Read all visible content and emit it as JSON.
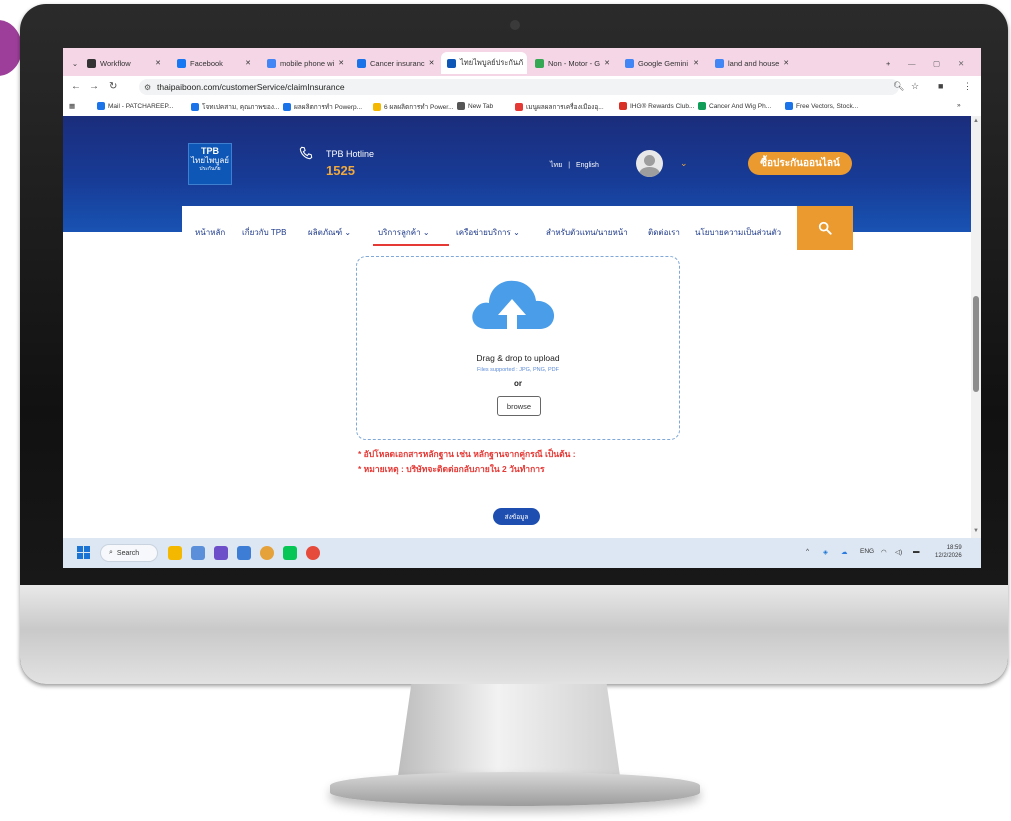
{
  "browser": {
    "tabs": [
      {
        "label": "Workflow",
        "icon": "globe-icon",
        "color": "#333333"
      },
      {
        "label": "Facebook",
        "icon": "facebook-icon",
        "color": "#1877f2"
      },
      {
        "label": "mobile phone wi",
        "icon": "google-icon",
        "color": "#4285f4"
      },
      {
        "label": "Cancer insuranc",
        "icon": "doc-icon",
        "color": "#1a73e8"
      },
      {
        "label": "ไทยไพบูลย์ประกันภั",
        "icon": "tpb-icon",
        "color": "#0e57b6",
        "active": true
      },
      {
        "label": "Non - Motor - G",
        "icon": "drive-icon",
        "color": "#34a853"
      },
      {
        "label": "Google Gemini",
        "icon": "gemini-icon",
        "color": "#4285f4"
      },
      {
        "label": "land and house",
        "icon": "google-icon",
        "color": "#4285f4"
      }
    ],
    "new_tab_label": "+",
    "url": "thaipaiboon.com/customerService/claimInsurance",
    "bookmarks": [
      {
        "label": "Mail - PATCHAREEP..."
      },
      {
        "label": "โจทเปคสาม, คุณภาพของ..."
      },
      {
        "label": "ผลผลิตการทำ Powerp..."
      },
      {
        "label": "6 ผลผลิตการทำ Power..."
      },
      {
        "label": "New Tab"
      },
      {
        "label": "เมนูผลผลการเครื่องเมืองอุ..."
      },
      {
        "label": "IHG® Rewards Club..."
      },
      {
        "label": "Cancer And Wig Ph..."
      },
      {
        "label": "Free Vectors, Stock..."
      }
    ],
    "more_bookmarks": "»"
  },
  "site": {
    "logo_line1": "TPB",
    "logo_line2": "ไทยไพบูลย์",
    "logo_line3": "ประกันภัย",
    "hotline_label": "TPB Hotline",
    "hotline_number": "1525",
    "lang_th": "ไทย",
    "lang_sep": "|",
    "lang_en": "English",
    "buy_button": "ซื้อประกันออนไลน์",
    "nav": [
      {
        "label": "หน้าหลัก"
      },
      {
        "label": "เกี่ยวกับ TPB"
      },
      {
        "label": "ผลิตภัณฑ์"
      },
      {
        "label": "บริการลูกค้า"
      },
      {
        "label": "เครือข่ายบริการ"
      },
      {
        "label": "สำหรับตัวแทน/นายหน้า"
      },
      {
        "label": "ติดต่อเรา"
      },
      {
        "label": "นโยบายความเป็นส่วนตัว"
      }
    ],
    "upload": {
      "title": "Drag & drop to upload",
      "supported": "Files supported : JPG, PNG, PDF",
      "or": "or",
      "browse": "browse"
    },
    "note1": "* อัปโหลดเอกสารหลักฐาน เช่น หลักฐานจากคู่กรณี เป็นต้น :",
    "note2": "* หมายเหตุ : บริษัทจะติดต่อกลับภายใน 2 วันทำการ",
    "submit": "ส่งข้อมูล",
    "colors": {
      "header": "#1b2d7c",
      "accent": "#eb9a2f",
      "note": "#e53935",
      "submit": "#1e4fb0"
    }
  },
  "taskbar": {
    "search_label": "Search",
    "lang": "ENG",
    "time": "18:59",
    "date": "12/2/2026"
  }
}
